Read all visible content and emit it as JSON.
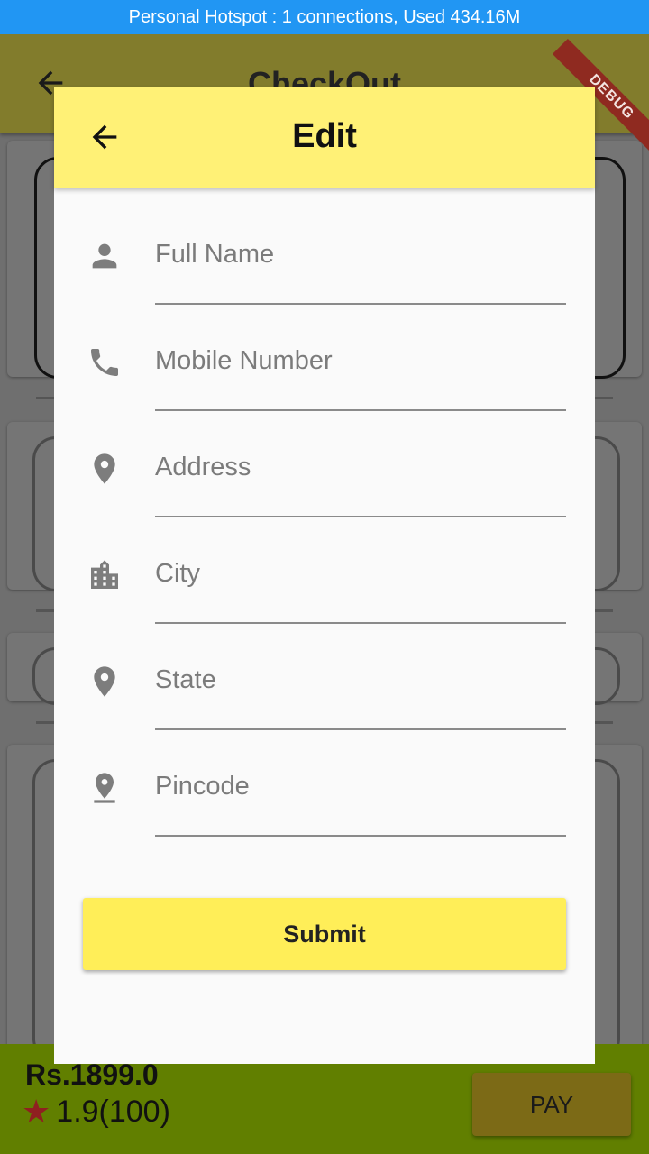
{
  "status_bar": {
    "text": "Personal Hotspot : 1 connections, Used 434.16M"
  },
  "background_page": {
    "title": "CheckOut",
    "debug_banner": "DEBUG",
    "bottom": {
      "price": "Rs.1899.0",
      "rating": "1.9(100)",
      "pay_label": "PAY"
    }
  },
  "dialog": {
    "title": "Edit",
    "fields": [
      {
        "icon": "person-icon",
        "placeholder": "Full Name",
        "value": ""
      },
      {
        "icon": "phone-icon",
        "placeholder": "Mobile Number",
        "value": ""
      },
      {
        "icon": "location-pin-icon",
        "placeholder": "Address",
        "value": ""
      },
      {
        "icon": "city-icon",
        "placeholder": "City",
        "value": ""
      },
      {
        "icon": "location-pin-icon",
        "placeholder": "State",
        "value": ""
      },
      {
        "icon": "pin-drop-icon",
        "placeholder": "Pincode",
        "value": ""
      }
    ],
    "submit_label": "Submit"
  }
}
